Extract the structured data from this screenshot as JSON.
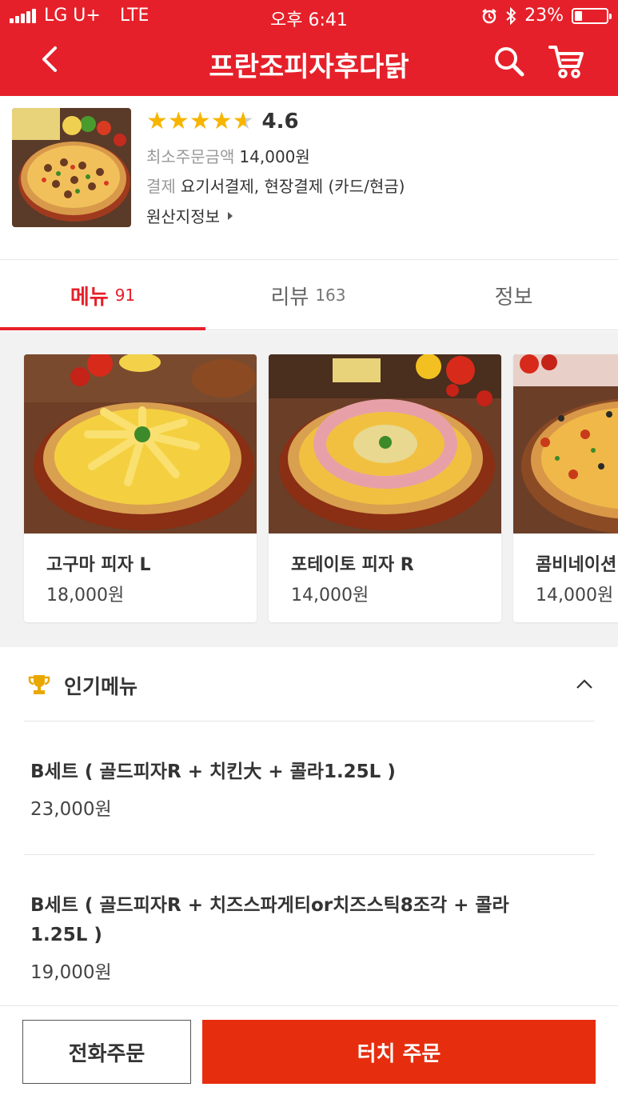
{
  "status_bar": {
    "carrier": "LG U+",
    "network": "LTE",
    "time": "오후 6:41",
    "battery_percent": "23%",
    "battery_level": 0.23
  },
  "nav": {
    "title": "프란조피자후다닭",
    "back_icon": "chevron-left-icon",
    "search_icon": "search-icon",
    "cart_icon": "cart-icon"
  },
  "store": {
    "rating": "4.6",
    "rating_value": 4.6,
    "min_order_label": "최소주문금액",
    "min_order_value": "14,000원",
    "payment_label": "결제",
    "payment_value": "요기서결제, 현장결제 (카드/현금)",
    "origin_label": "원산지정보"
  },
  "tabs": [
    {
      "label": "메뉴",
      "count": "91"
    },
    {
      "label": "리뷰",
      "count": "163"
    },
    {
      "label": "정보",
      "count": ""
    }
  ],
  "featured": [
    {
      "name": "고구마 피자 L",
      "price": "18,000원"
    },
    {
      "name": "포테이토 피자 R",
      "price": "14,000원"
    },
    {
      "name": "콤비네이션",
      "price": "14,000원"
    }
  ],
  "popular": {
    "title": "인기메뉴",
    "items": [
      {
        "name": "B세트 ( 골드피자R + 치킨大 + 콜라1.25L )",
        "price": "23,000원"
      },
      {
        "name": "B세트 ( 골드피자R + 치즈스파게티or치즈스틱8조각 + 콜라1.25L )",
        "price": "19,000원"
      }
    ]
  },
  "bottom": {
    "call_label": "전화주문",
    "touch_label": "터치 주문"
  },
  "colors": {
    "brand_red": "#e6202a",
    "order_button": "#e62e0e",
    "star": "#f7b500"
  }
}
